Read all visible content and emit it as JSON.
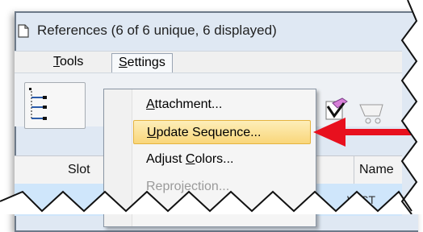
{
  "window": {
    "title": "References (6 of 6 unique, 6 displayed)"
  },
  "menubar": {
    "tools": {
      "prefix": "",
      "mnemonic": "T",
      "rest": "ools"
    },
    "settings": {
      "prefix": "",
      "mnemonic": "S",
      "rest": "ettings"
    }
  },
  "dropdown": {
    "items": [
      {
        "prefix": "",
        "mnemonic": "A",
        "rest": "ttachment...",
        "state": "normal"
      },
      {
        "prefix": "",
        "mnemonic": "U",
        "rest": "pdate Sequence...",
        "state": "selected"
      },
      {
        "prefix": "Adjust ",
        "mnemonic": "C",
        "rest": "olors...",
        "state": "normal"
      },
      {
        "prefix": "",
        "mnemonic": "",
        "rest": "Reprojection...",
        "state": "disabled"
      }
    ]
  },
  "grid": {
    "columns": {
      "slot": "Slot",
      "name": "Name"
    },
    "first_row_fragment": "W ST"
  },
  "colors": {
    "arrow": "#e8101e",
    "highlight": "#f9d67a",
    "row_selection": "#cfe6fb"
  },
  "icons": [
    "document-icon",
    "tree-view-icon",
    "eraser-icon",
    "checkmark-icon",
    "cart-icon",
    "callout-arrow"
  ]
}
